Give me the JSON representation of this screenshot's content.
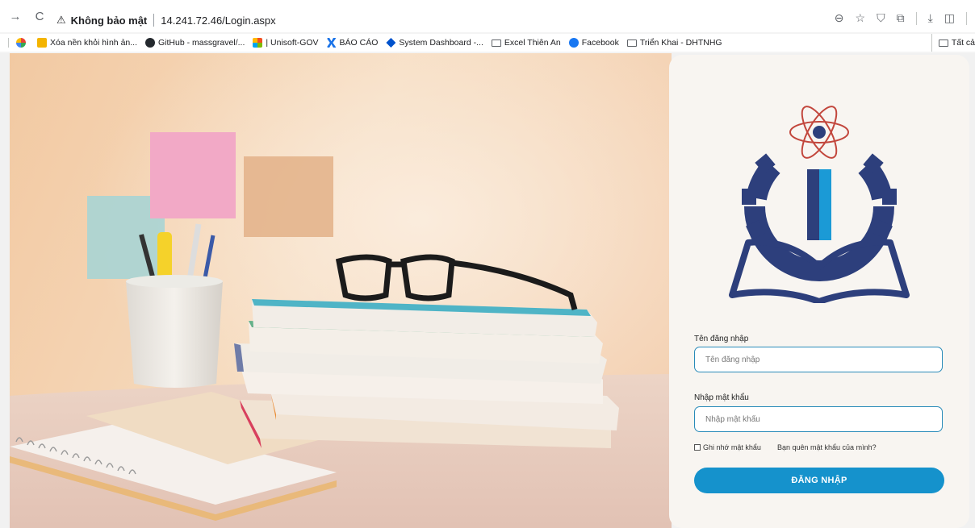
{
  "browser": {
    "security_label": "Không bảo mật",
    "url": "14.241.72.46/Login.aspx"
  },
  "bookmarks": [
    {
      "label": "Xóa nền khỏi hình ản...",
      "icon": "remove-bg-icon",
      "color": "#f4b400"
    },
    {
      "label": "GitHub - massgravel/...",
      "icon": "github-icon",
      "color": "#24292e"
    },
    {
      "label": "| Unisoft-GOV",
      "icon": "windows-icon",
      "color": "#f25022"
    },
    {
      "label": "BÁO CÁO",
      "icon": "x-logo-icon",
      "color": "#1a73e8"
    },
    {
      "label": "System Dashboard -...",
      "icon": "jira-icon",
      "color": "#0052cc"
    },
    {
      "label": "Excel Thiên An",
      "icon": "folder-icon",
      "color": "#5f6368"
    },
    {
      "label": "Facebook",
      "icon": "facebook-icon",
      "color": "#1877f2"
    },
    {
      "label": "Triển Khai - DHTNHG",
      "icon": "folder-icon",
      "color": "#5f6368"
    }
  ],
  "bookmarks_right": "Tất cả",
  "login": {
    "username_label": "Tên đăng nhập",
    "username_placeholder": "Tên đăng nhập",
    "password_label": "Nhập mật khẩu",
    "password_placeholder": "Nhập mật khẩu",
    "remember_label": "Ghi nhớ mật khẩu",
    "forgot_label": "Bạn quên mật khẩu của mình?",
    "submit_label": "ĐĂNG NHẬP"
  },
  "colors": {
    "accent": "#1592cc",
    "logo_navy": "#2d3f7c",
    "logo_cyan": "#1b9ad6",
    "logo_red": "#c2463c"
  }
}
